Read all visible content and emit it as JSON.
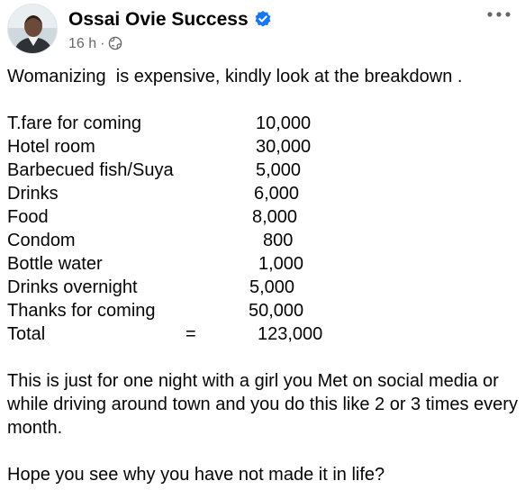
{
  "post": {
    "author": "Ossai Ovie Success",
    "time": "16 h",
    "separator": "·",
    "intro": "Womanizing  is expensive, kindly look at the breakdown .",
    "breakdown": [
      {
        "item": "T.fare for coming",
        "amount": "10,000"
      },
      {
        "item": "Hotel room",
        "amount": "30,000"
      },
      {
        "item": "Barbecued fish/Suya",
        "amount": "5,000"
      },
      {
        "item": "Drinks",
        "amount": "6,000"
      },
      {
        "item": "Food",
        "amount": "8,000"
      },
      {
        "item": "Condom",
        "amount": "800"
      },
      {
        "item": "Bottle water",
        "amount": "1,000"
      },
      {
        "item": "Drinks overnight",
        "amount": "5,000"
      },
      {
        "item": "Thanks for coming",
        "amount": "50,000"
      }
    ],
    "total": {
      "label": "Total",
      "equals": "=",
      "amount": "123,000"
    },
    "paragraph1": "This is just for one night with a girl you Met on social media or while driving around town and you do this like 2 or 3 times every month.",
    "paragraph2": "Hope you see why you have not made it in life?"
  },
  "icons": {
    "verified": "verified-badge-icon",
    "audience": "globe-icon",
    "more": "more-options-icon"
  },
  "colors": {
    "verified": "#1877f2",
    "meta_text": "#65676b",
    "body_text": "#050505"
  }
}
